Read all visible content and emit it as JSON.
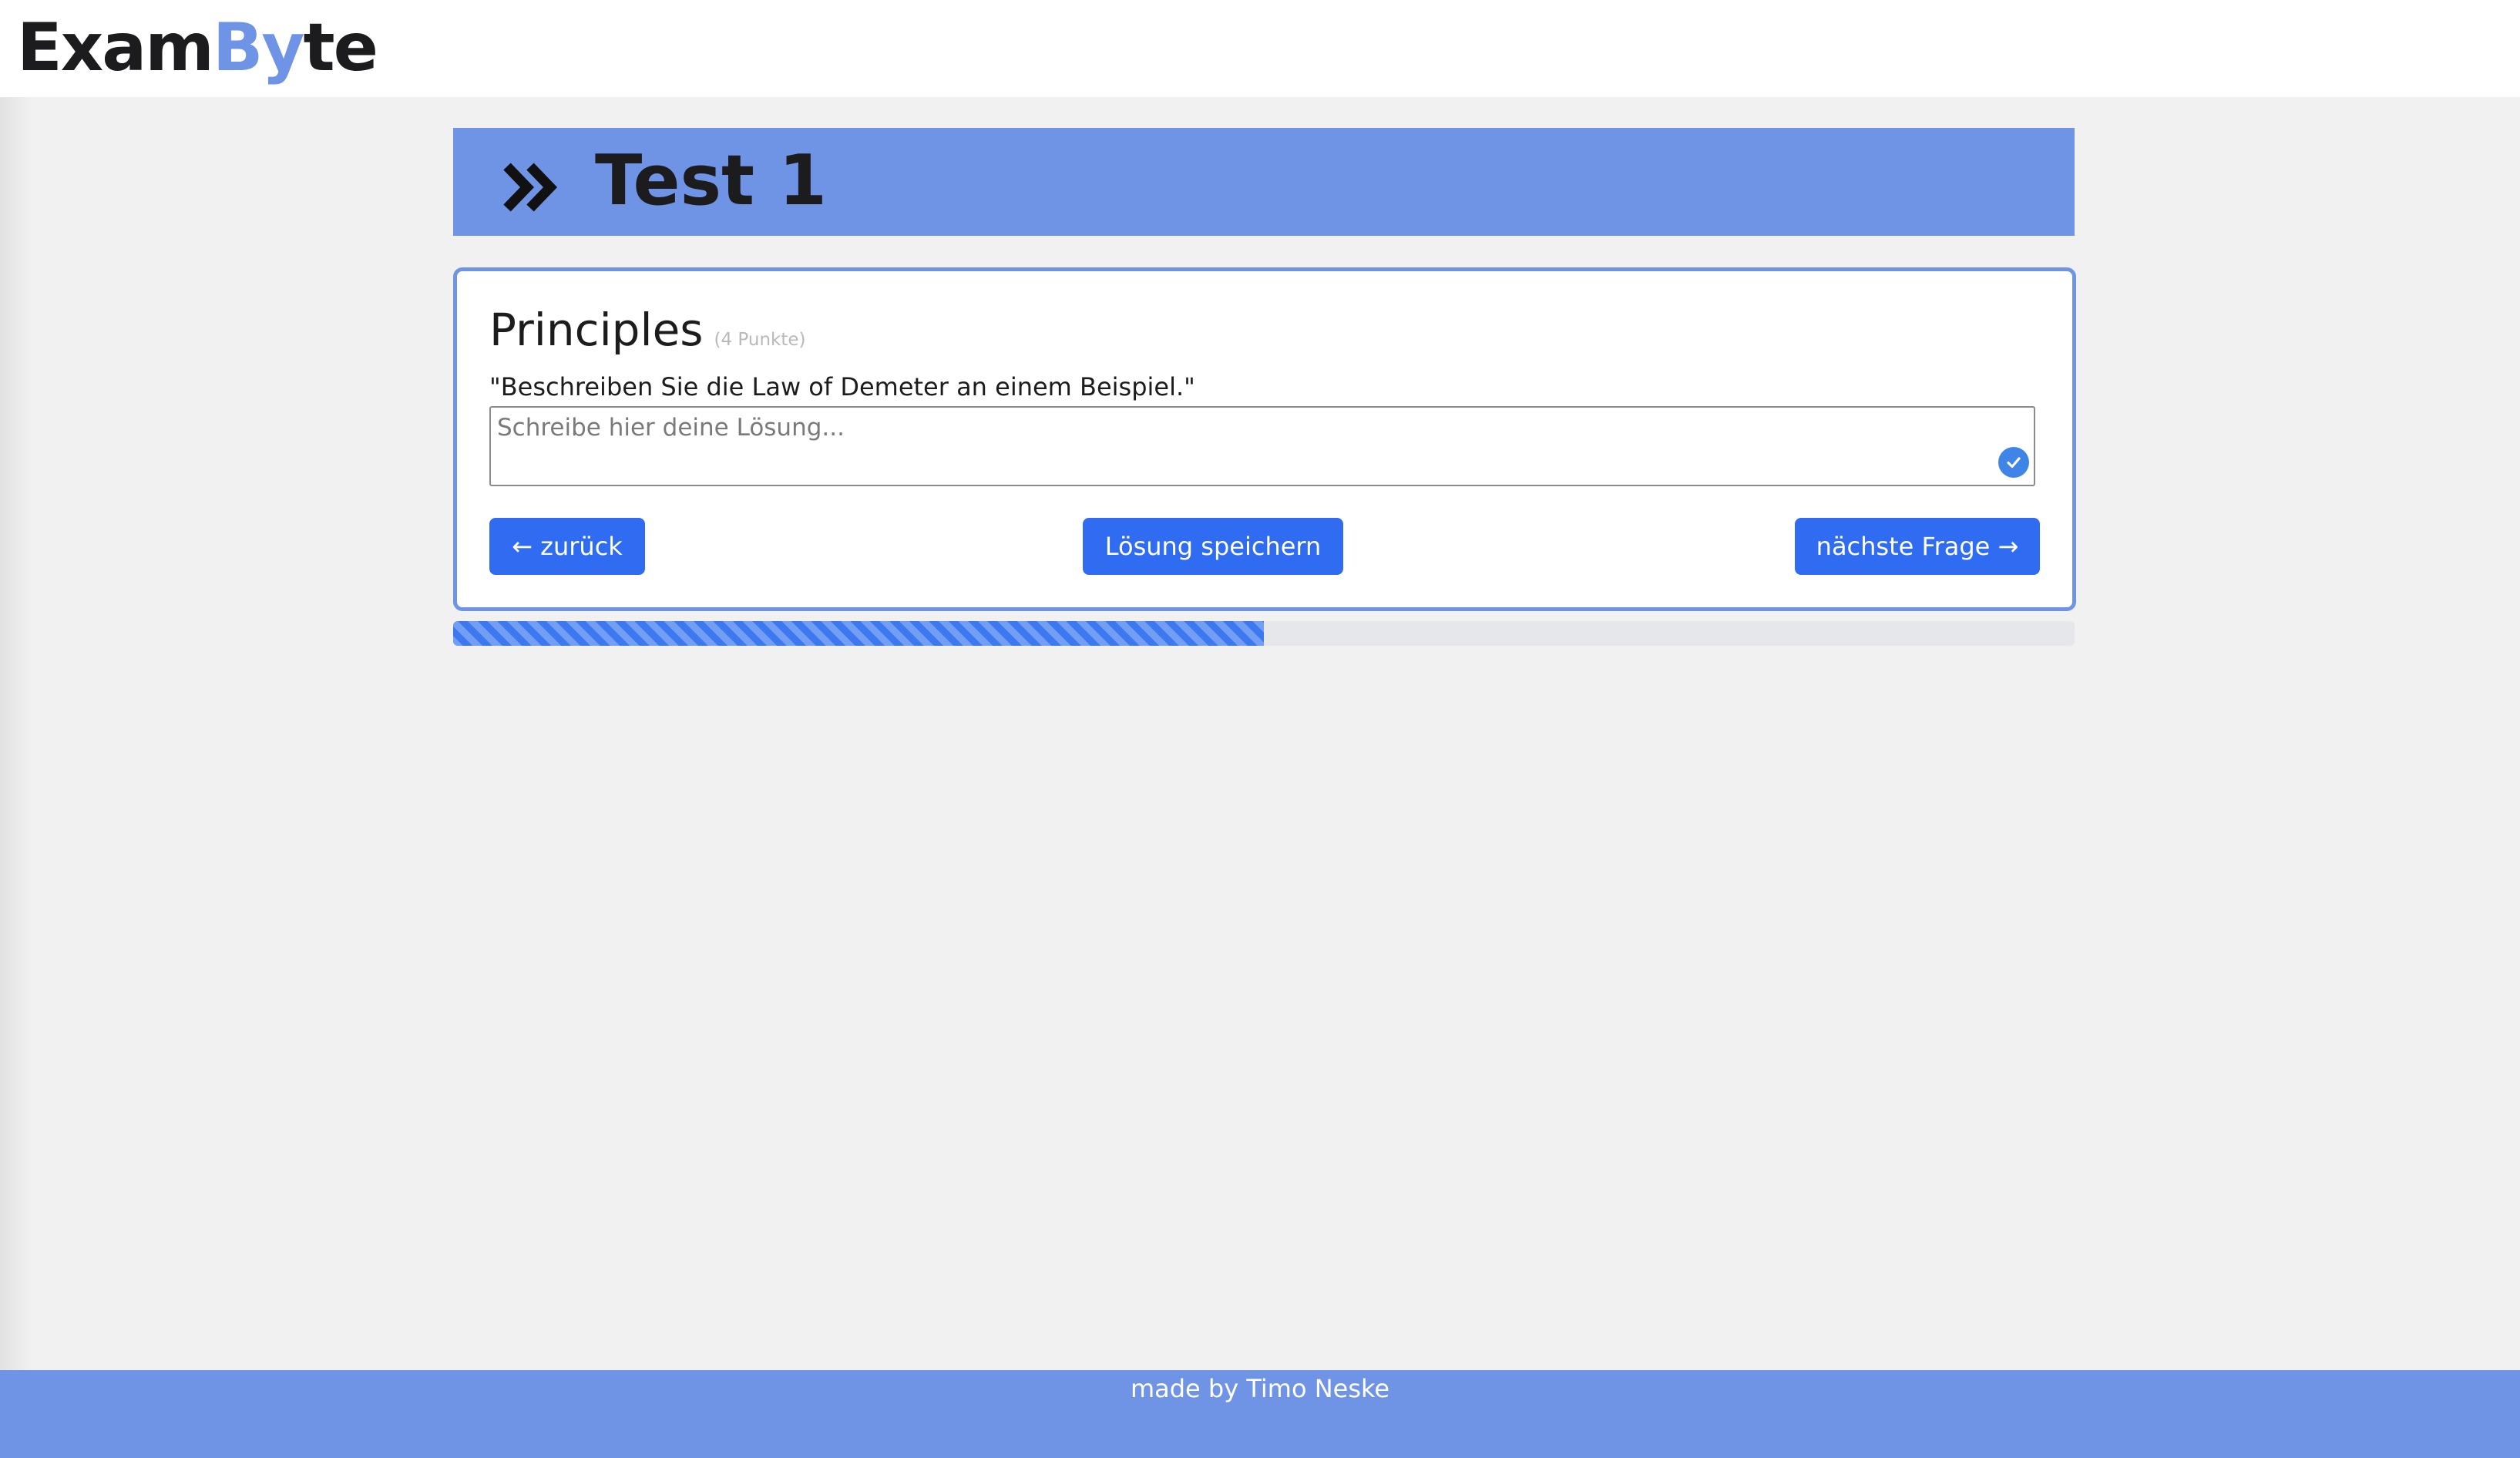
{
  "app": {
    "logo_part1": "Exam",
    "logo_part2": "By",
    "logo_part3": "te"
  },
  "banner": {
    "icon": "double-chevron-right-icon",
    "title": "Test 1"
  },
  "question": {
    "title": "Principles",
    "points": "(4 Punkte)",
    "text": "\"Beschreiben Sie die Law of Demeter an einem Beispiel.\"",
    "answer_value": "",
    "answer_placeholder": "Schreibe hier deine Lösung...",
    "status_icon": "check-circle-icon"
  },
  "actions": {
    "back_label": "← zurück",
    "save_label": "Lösung speichern",
    "next_label": "nächste Frage →"
  },
  "progress": {
    "fraction": 0.5
  },
  "footer": {
    "text": "made by Timo Neske"
  },
  "colors": {
    "accent": "#6f94e6",
    "button": "#2f6cf2",
    "progress": "#3c78f0",
    "page_background": "#f1f1f1"
  }
}
